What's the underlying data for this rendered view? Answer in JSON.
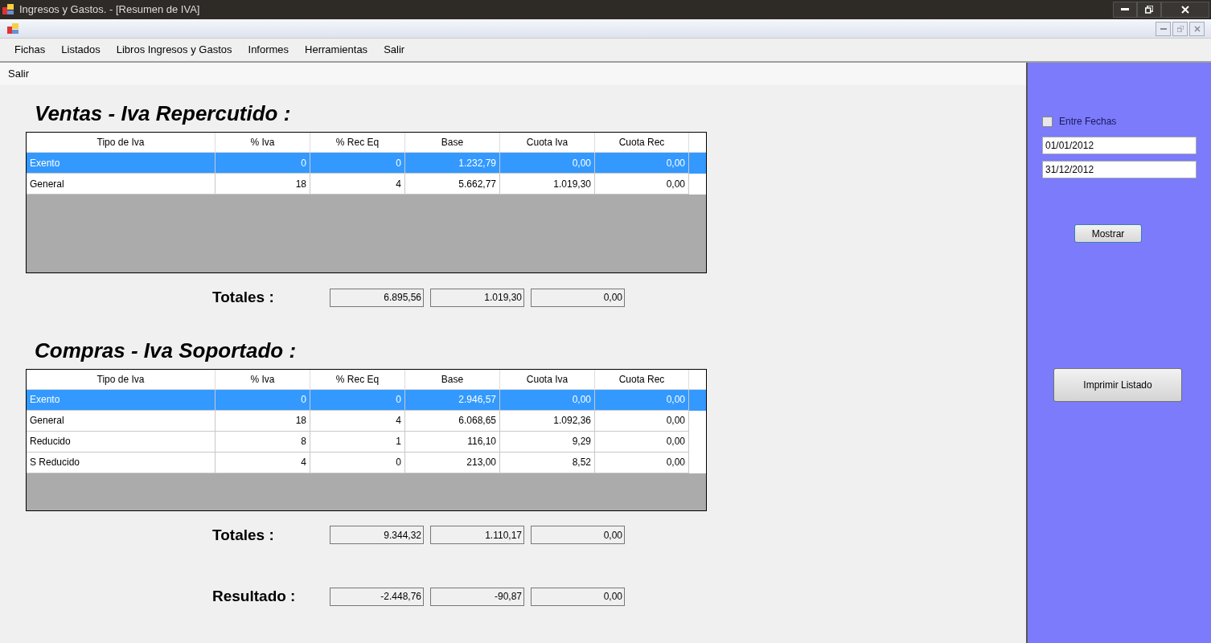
{
  "window": {
    "title": "Ingresos y Gastos. - [Resumen de IVA]"
  },
  "menu": [
    "Fichas",
    "Listados",
    "Libros Ingresos y Gastos",
    "Informes",
    "Herramientas",
    "Salir"
  ],
  "submenu": [
    "Salir"
  ],
  "sections": [
    {
      "title": "Ventas - Iva Repercutido :",
      "columns": [
        "Tipo de Iva",
        "% Iva",
        "% Rec Eq",
        "Base",
        "Cuota Iva",
        "Cuota Rec"
      ],
      "rows": [
        {
          "selected": true,
          "cells": [
            "Exento",
            "0",
            "0",
            "1.232,79",
            "0,00",
            "0,00"
          ]
        },
        {
          "selected": false,
          "cells": [
            "General",
            "18",
            "4",
            "5.662,77",
            "1.019,30",
            "0,00"
          ]
        }
      ],
      "totals_label": "Totales :",
      "totals": [
        "6.895,56",
        "1.019,30",
        "0,00"
      ]
    },
    {
      "title": "Compras - Iva Soportado :",
      "columns": [
        "Tipo de Iva",
        "% Iva",
        "% Rec Eq",
        "Base",
        "Cuota Iva",
        "Cuota Rec"
      ],
      "rows": [
        {
          "selected": true,
          "cells": [
            "Exento",
            "0",
            "0",
            "2.946,57",
            "0,00",
            "0,00"
          ]
        },
        {
          "selected": false,
          "cells": [
            "General",
            "18",
            "4",
            "6.068,65",
            "1.092,36",
            "0,00"
          ]
        },
        {
          "selected": false,
          "cells": [
            "Reducido",
            "8",
            "1",
            "116,10",
            "9,29",
            "0,00"
          ]
        },
        {
          "selected": false,
          "cells": [
            "S Reducido",
            "4",
            "0",
            "213,00",
            "8,52",
            "0,00"
          ]
        }
      ],
      "totals_label": "Totales :",
      "totals": [
        "9.344,32",
        "1.110,17",
        "0,00"
      ]
    }
  ],
  "result": {
    "label": "Resultado :",
    "values": [
      "-2.448,76",
      "-90,87",
      "0,00"
    ]
  },
  "side": {
    "checkbox": {
      "label": "Entre Fechas",
      "checked": false
    },
    "date_from": "01/01/2012",
    "date_to": "31/12/2012",
    "show_button": "Mostrar",
    "print_button": "Imprimir Listado"
  }
}
